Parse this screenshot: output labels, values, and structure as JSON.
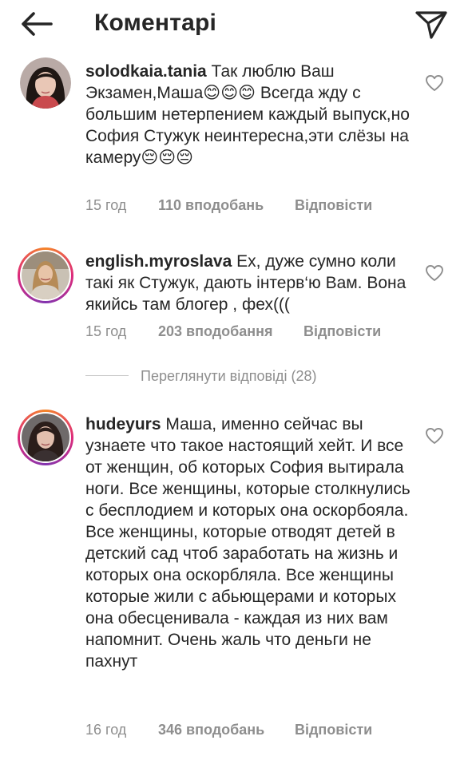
{
  "header": {
    "title": "Коментарі",
    "back_icon": "arrow-left-icon",
    "share_icon": "paper-plane-icon"
  },
  "comments": [
    {
      "username": "solodkaia.tania",
      "text": " Так люблю Ваш Экзамен,Маша😊😊😊 Всегда жду с большим нетерпением каждый выпуск,но София Стужук неинтересна,эти слёзы на камеру😔😔😔",
      "time": "15 год",
      "likes": "110 вподобань",
      "reply": "Відповісти",
      "avatar_ring": false
    },
    {
      "username": "english.myroslava",
      "text": " Ех, дуже сумно коли такі як Стужук, дають інтерв‘ю Вам. Вона якийсь там блогер , фех(((",
      "time": "15 год",
      "likes": "203 вподобання",
      "reply": "Відповісти",
      "avatar_ring": true
    },
    {
      "username": "hudeyurs",
      "text": " Маша, именно сейчас вы узнаете что такое настоящий хейт. И все от женщин, об которых София вытирала ноги. Все  женщины, которые столкнулись с бесплодием и которых она оскорбояла. Все женщины, которые отводят детей в детский сад чтоб заработать на жизнь и которых она оскорбляла. Все женщины которые жили с абьющерами и которых она обесценивала - каждая из них вам напомнит. Очень жаль что деньги не пахнут",
      "time": "16 год",
      "likes": "346 вподобань",
      "reply": "Відповісти",
      "avatar_ring": true
    }
  ],
  "view_replies": "Переглянути відповіді (28)",
  "colors": {
    "text": "#262626",
    "secondary": "#8e8e8e",
    "divider": "#c7c7c7"
  }
}
